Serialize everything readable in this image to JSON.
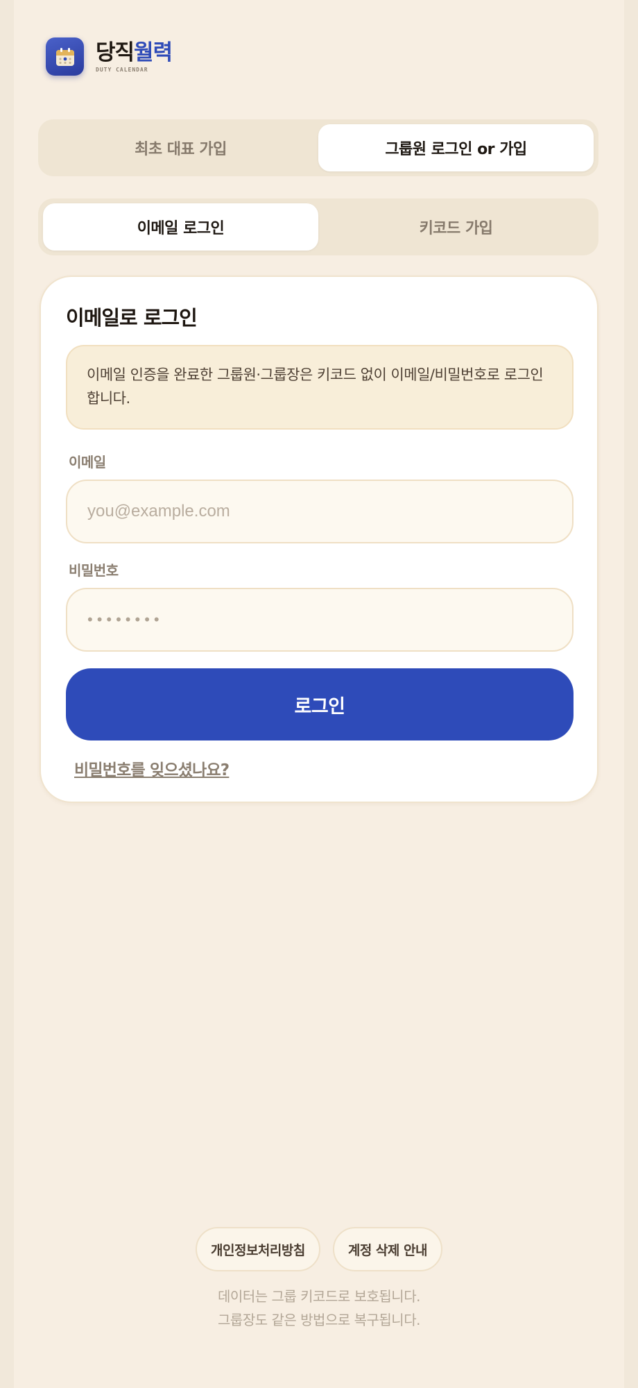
{
  "brand": {
    "title_dark": "당직",
    "title_blue": "월력",
    "subtitle": "DUTY CALENDAR",
    "icon": "calendar-icon",
    "accent": "#2f4bb8"
  },
  "mode_tabs": [
    {
      "label": "최초 대표 가입",
      "active": false
    },
    {
      "label": "그룹원 로그인 or 가입",
      "active": true
    }
  ],
  "method_tabs": [
    {
      "label": "이메일 로그인",
      "active": true
    },
    {
      "label": "키코드 가입",
      "active": false
    }
  ],
  "card": {
    "title": "이메일로 로그인",
    "notice": "이메일 인증을 완료한 그룹원·그룹장은 키코드 없이 이메일/비밀번호로 로그인합니다.",
    "email_label": "이메일",
    "email_value": "",
    "email_placeholder": "you@example.com",
    "password_label": "비밀번호",
    "password_value": "",
    "password_placeholder": "••••••••",
    "login_button": "로그인",
    "forgot_link": "비밀번호를 잊으셨나요?"
  },
  "footer": {
    "privacy_link": "개인정보처리방침",
    "delete_link": "계정 삭제 안내",
    "note_line1": "데이터는 그룹 키코드로 보호됩니다.",
    "note_line2": "그룹장도 같은 방법으로 복구됩니다."
  },
  "colors": {
    "primary_button": "#2e4bb9",
    "background": "#f7eee2",
    "notice_bg": "#f8eed9"
  }
}
